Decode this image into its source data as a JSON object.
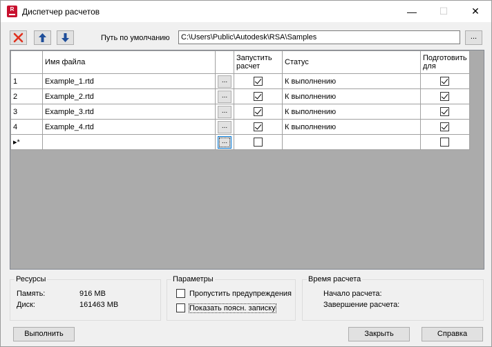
{
  "window": {
    "title": "Диспетчер расчетов",
    "icon_letter": "R",
    "controls": {
      "minimize": "—",
      "maximize": "☐",
      "close": "✕"
    }
  },
  "toolbar": {
    "delete_icon": "close-icon",
    "up_icon": "arrow-up-icon",
    "down_icon": "arrow-down-icon",
    "path_label": "Путь по умолчанию",
    "path_value": "C:\\Users\\Public\\Autodesk\\RSA\\Samples",
    "browse_label": "..."
  },
  "grid": {
    "columns": {
      "file": "Имя файла",
      "run_line1": "Запустить",
      "run_line2": "расчет",
      "status": "Статус",
      "prepare_line1": "Подготовить",
      "prepare_line2": "для"
    },
    "browse_label": "...",
    "rows": [
      {
        "num": "1",
        "file": "Example_1.rtd",
        "run": true,
        "status": "К выполнению",
        "prepare": true
      },
      {
        "num": "2",
        "file": "Example_2.rtd",
        "run": true,
        "status": "К выполнению",
        "prepare": true
      },
      {
        "num": "3",
        "file": "Example_3.rtd",
        "run": true,
        "status": "К выполнению",
        "prepare": true
      },
      {
        "num": "4",
        "file": "Example_4.rtd",
        "run": true,
        "status": "К выполнению",
        "prepare": true
      }
    ],
    "new_row_marker": "▸*"
  },
  "resources": {
    "title": "Ресурсы",
    "memory_label": "Память:",
    "memory_value": "916 MB",
    "disk_label": "Диск:",
    "disk_value": "161463 MB"
  },
  "params": {
    "title": "Параметры",
    "skip_warnings": "Пропустить предупреждения",
    "show_note": "Показать поясн. записку"
  },
  "timing": {
    "title": "Время расчета",
    "start_label": "Начало расчета:",
    "end_label": "Завершение расчета:"
  },
  "buttons": {
    "run": "Выполнить",
    "close": "Закрыть",
    "help": "Справка"
  }
}
